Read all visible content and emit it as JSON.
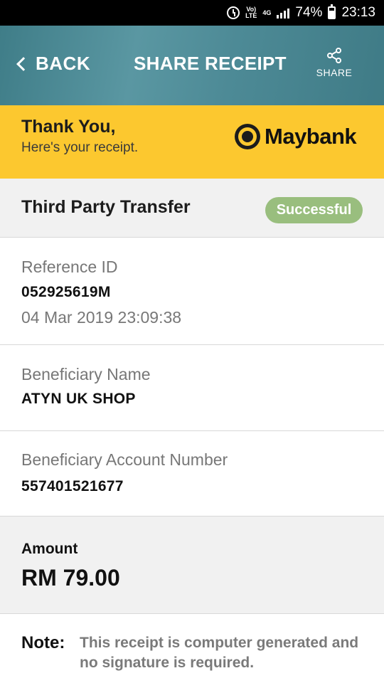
{
  "status_bar": {
    "network_top": "Vo)",
    "network_bottom": "LTE",
    "net_type": "4G",
    "battery_percent": "74%",
    "time": "23:13"
  },
  "header": {
    "back_label": "BACK",
    "title": "SHARE RECEIPT",
    "share_label": "SHARE"
  },
  "banner": {
    "thanks": "Thank You,",
    "subtitle": "Here's your receipt.",
    "brand": "Maybank",
    "brand_color": "#fcc82f"
  },
  "transaction": {
    "type": "Third Party Transfer",
    "status": "Successful",
    "status_color": "#99be7e"
  },
  "reference": {
    "label": "Reference ID",
    "id": "052925619M",
    "datetime": "04 Mar 2019 23:09:38"
  },
  "beneficiary_name": {
    "label": "Beneficiary Name",
    "value": "ATYN UK SHOP"
  },
  "beneficiary_account": {
    "label": "Beneficiary Account Number",
    "value": "557401521677"
  },
  "amount": {
    "label": "Amount",
    "value": "RM 79.00"
  },
  "note": {
    "label": "Note:",
    "text": "This receipt is computer generated and no signature is required."
  }
}
